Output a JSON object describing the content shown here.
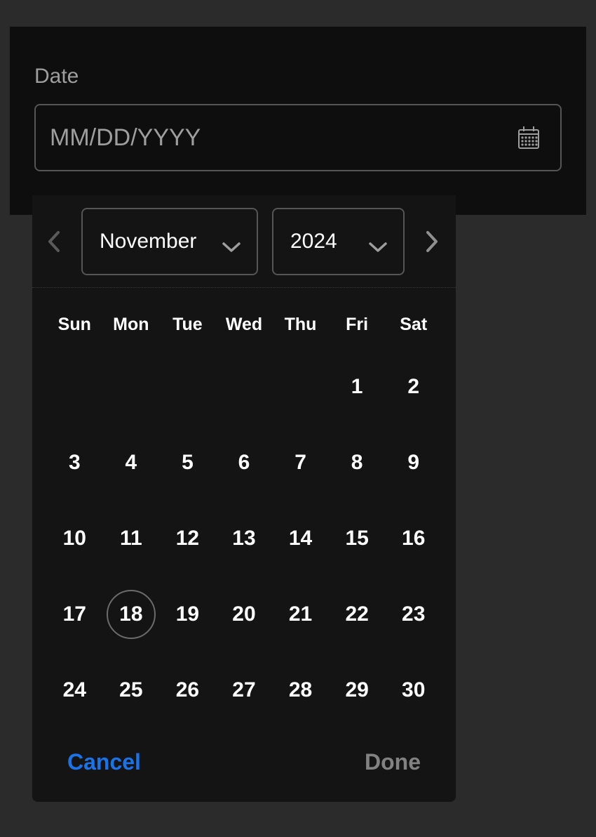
{
  "field": {
    "label": "Date",
    "placeholder": "MM/DD/YYYY"
  },
  "picker": {
    "month": "November",
    "year": "2024",
    "weekdays": [
      "Sun",
      "Mon",
      "Tue",
      "Wed",
      "Thu",
      "Fri",
      "Sat"
    ],
    "leading_blanks": 5,
    "days": [
      1,
      2,
      3,
      4,
      5,
      6,
      7,
      8,
      9,
      10,
      11,
      12,
      13,
      14,
      15,
      16,
      17,
      18,
      19,
      20,
      21,
      22,
      23,
      24,
      25,
      26,
      27,
      28,
      29,
      30
    ],
    "today": 18
  },
  "actions": {
    "cancel": "Cancel",
    "done": "Done"
  }
}
